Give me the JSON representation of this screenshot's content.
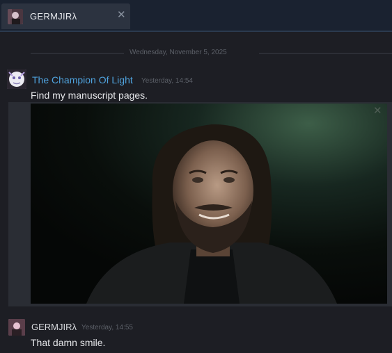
{
  "tab": {
    "name": "GERMJIRλ",
    "close_glyph": "✕"
  },
  "date_divider": "Wednesday, November 5, 2025",
  "messages": [
    {
      "sender": "The Champion Of Light",
      "timestamp": "Yesterday, 14:54",
      "text": "Find my manuscript pages.",
      "sender_color": "#4fa3de",
      "has_image": true
    },
    {
      "sender": "GERMJIRλ",
      "timestamp": "Yesterday, 14:55",
      "text": "That damn smile.",
      "sender_color": "#d7d9dd"
    }
  ],
  "embed": {
    "close_glyph": "✕"
  },
  "colors": {
    "background": "#1d1e24",
    "tabbar": "#1a2230",
    "accent_blue": "#4fa3de"
  }
}
